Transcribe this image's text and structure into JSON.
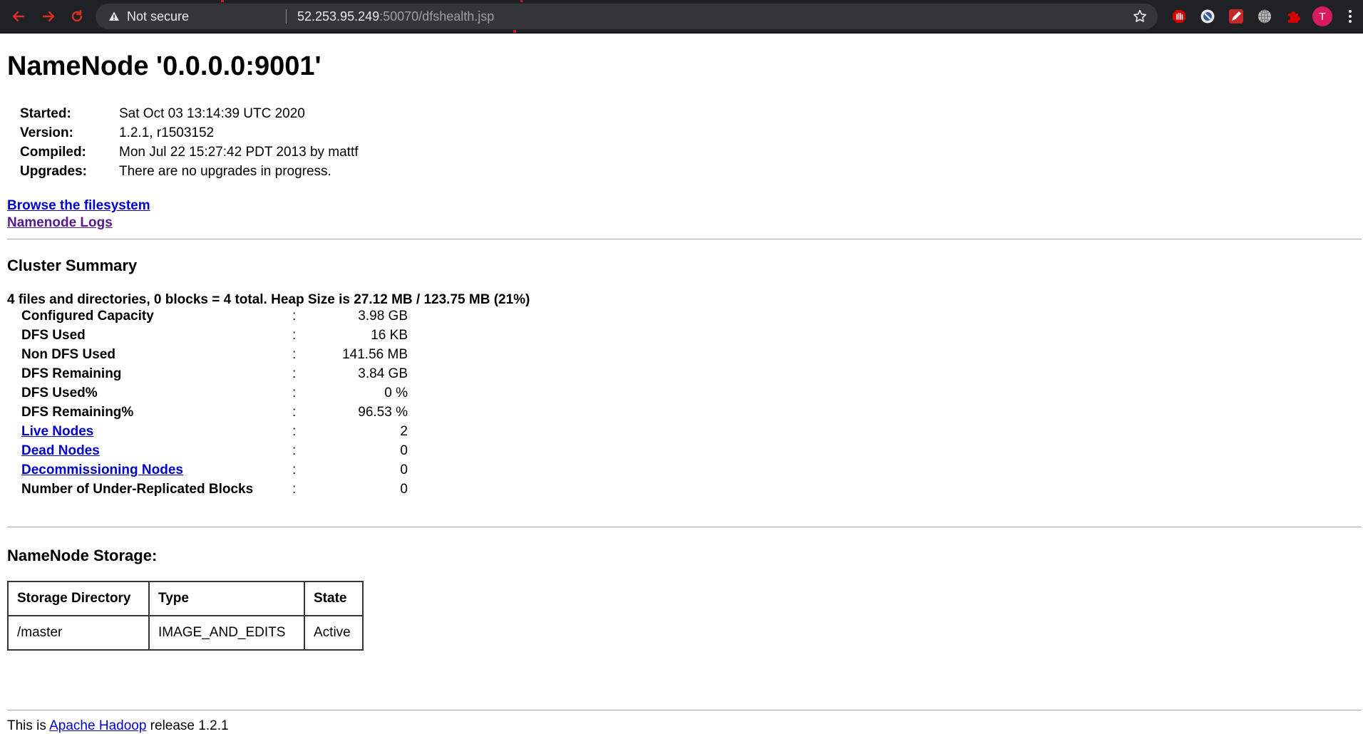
{
  "browser": {
    "security_label": "Not secure",
    "url_host": "52.253.95.249",
    "url_rest": ":50070/dfshealth.jsp",
    "profile_initial": "T",
    "colors": {
      "chrome": "#202124",
      "omnibox": "#35363a",
      "accent": "#c8202a",
      "profile": "#d81b60"
    }
  },
  "page": {
    "title": "NameNode '0.0.0.0:9001'",
    "info": [
      {
        "label": "Started:",
        "value": "Sat Oct 03 13:14:39 UTC 2020"
      },
      {
        "label": "Version:",
        "value": "1.2.1, r1503152"
      },
      {
        "label": "Compiled:",
        "value": "Mon Jul 22 15:27:42 PDT 2013 by mattf"
      },
      {
        "label": "Upgrades:",
        "value": "There are no upgrades in progress."
      }
    ],
    "links": {
      "browse": "Browse the filesystem",
      "logs": "Namenode Logs"
    },
    "cluster": {
      "heading": "Cluster Summary",
      "summary_line": "4 files and directories, 0 blocks = 4 total. Heap Size is 27.12 MB / 123.75 MB (21%)",
      "rows": [
        {
          "label": "Configured Capacity",
          "sep": ":",
          "value": "3.98 GB"
        },
        {
          "label": "DFS Used",
          "sep": ":",
          "value": "16 KB"
        },
        {
          "label": "Non DFS Used",
          "sep": ":",
          "value": "141.56 MB"
        },
        {
          "label": "DFS Remaining",
          "sep": ":",
          "value": "3.84 GB"
        },
        {
          "label": "DFS Used%",
          "sep": ":",
          "value": "0 %"
        },
        {
          "label": "DFS Remaining%",
          "sep": ":",
          "value": "96.53 %"
        },
        {
          "label": "Live Nodes",
          "sep": ":",
          "value": "2"
        },
        {
          "label": "Dead Nodes",
          "sep": ":",
          "value": "0"
        },
        {
          "label": "Decommissioning Nodes",
          "sep": ":",
          "value": "0"
        },
        {
          "label": "Number of Under-Replicated Blocks",
          "sep": ":",
          "value": "0"
        }
      ]
    },
    "storage": {
      "heading": "NameNode Storage:",
      "headers": [
        "Storage Directory",
        "Type",
        "State"
      ],
      "row": [
        "/master",
        "IMAGE_AND_EDITS",
        "Active"
      ]
    },
    "footer": {
      "prefix": "This is ",
      "link": "Apache Hadoop",
      "suffix": " release 1.2.1"
    }
  }
}
